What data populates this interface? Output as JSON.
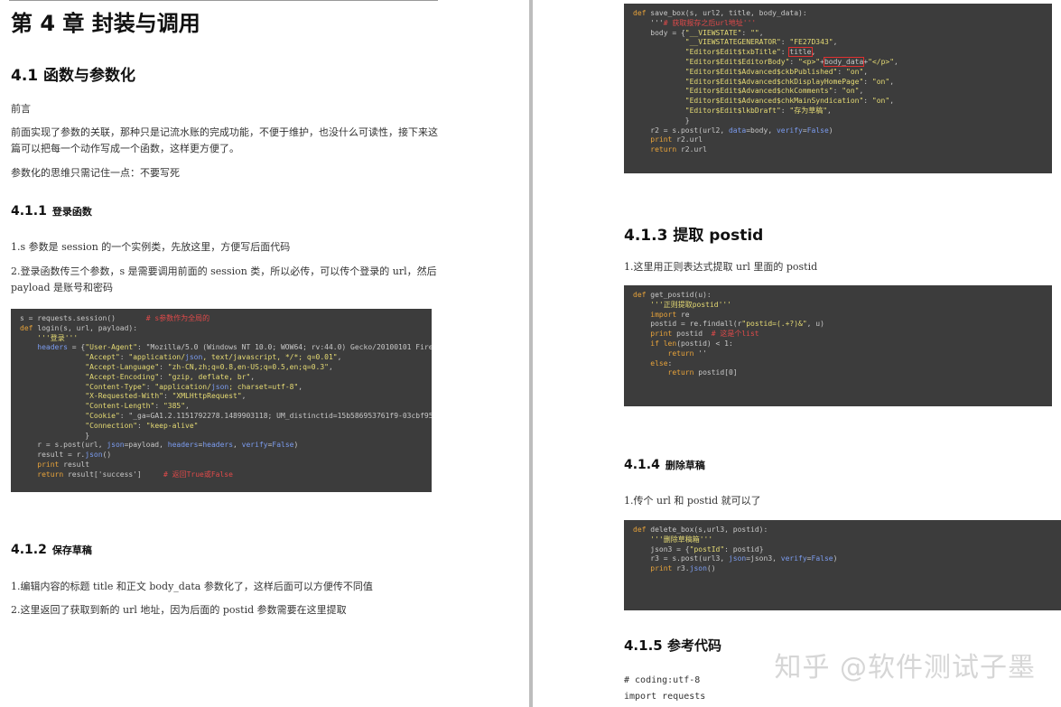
{
  "left": {
    "chapter_title": "第 4 章  封装与调用",
    "section_title": "4.1  函数与参数化",
    "preface_label": "前言",
    "preface_text": "前面实现了参数的关联，那种只是记流水账的完成功能，不便于维护，也没什么可读性，接下来这篇可以把每一个动作写成一个函数，这样更方便了。",
    "principle_text": "参数化的思维只需记住一点：不要写死",
    "s411": {
      "num": "4.1.1",
      "title": "登录函数"
    },
    "s411_p1": "1.s 参数是 session 的一个实例类，先放这里，方便写后面代码",
    "s411_p2": "2.登录函数传三个参数，s 是需要调用前面的 session 类，所以必传，可以传个登录的 url，然后 payload 是账号和密码",
    "login_code": [
      "s = requests.session()       # s参数作为全局的",
      "def login(s, url, payload):",
      "    '''登录'''",
      "    headers = {\"User-Agent\": \"Mozilla/5.0 (Windows NT 10.0; WOW64; rv:44.0) Gecko/20100101 Firef",
      "               \"Accept\": \"application/json, text/javascript, */*; q=0.01\",",
      "               \"Accept-Language\": \"zh-CN,zh;q=0.8,en-US;q=0.5,en;q=0.3\",",
      "               \"Accept-Encoding\": \"gzip, deflate, br\",",
      "               \"Content-Type\": \"application/json; charset=utf-8\",",
      "               \"X-Requested-With\": \"XMLHttpRequest\",",
      "               \"Content-Length\": \"385\",",
      "               \"Cookie\": \"_ga=GA1.2.1151792278.1489903118; UM_distinctid=15b586953761f9-03cbf959",
      "               \"Connection\": \"keep-alive\"",
      "               }",
      "    r = s.post(url, json=payload, headers=headers, verify=False)",
      "    result = r.json()",
      "    print result",
      "    return result['success']     # 返回True或False"
    ],
    "s412": {
      "num": "4.1.2",
      "title": "保存草稿"
    },
    "s412_p1": "1.编辑内容的标题 title 和正文 body_data 参数化了，这样后面可以方便传不同值",
    "s412_p2": "2.这里返回了获取到新的 url 地址，因为后面的 postid 参数需要在这里提取"
  },
  "right": {
    "save_code": [
      "def save_box(s, url2, title, body_data):",
      "    '''# 获取报存之后url地址'''",
      "    body = {\"__VIEWSTATE\": \"\",",
      "            \"__VIEWSTATEGENERATOR\": \"FE27D343\",",
      "            \"Editor$Edit$txbTitle\": title,",
      "            \"Editor$Edit$EditorBody\": \"<p>\"+body_data+\"</p>\",",
      "            \"Editor$Edit$Advanced$ckbPublished\": \"on\",",
      "            \"Editor$Edit$Advanced$chkDisplayHomePage\": \"on\",",
      "            \"Editor$Edit$Advanced$chkComments\": \"on\",",
      "            \"Editor$Edit$Advanced$chkMainSyndication\": \"on\",",
      "            \"Editor$Edit$lkbDraft\": \"存为草稿\",",
      "            }",
      "    r2 = s.post(url2, data=body, verify=False)",
      "    print r2.url",
      "    return r2.url"
    ],
    "s413": {
      "num": "4.1.3",
      "title": "提取 postid"
    },
    "s413_p1": "1.这里用正则表达式提取 url 里面的 postid",
    "postid_code": [
      "def get_postid(u):",
      "    '''正则提取postid'''",
      "    import re",
      "    postid = re.findall(r\"postid=(.+?)&\", u)",
      "    print postid  # 这是个list",
      "    if len(postid) < 1:",
      "        return ''",
      "    else:",
      "        return postid[0]"
    ],
    "s414": {
      "num": "4.1.4",
      "title": "删除草稿"
    },
    "s414_p1": "1.传个 url 和 postid 就可以了",
    "delete_code": [
      "def delete_box(s,url3, postid):",
      "    '''删除草稿箱'''",
      "    json3 = {\"postId\": postid}",
      "    r3 = s.post(url3, json=json3, verify=False)",
      "    print r3.json()"
    ],
    "s415": {
      "num": "4.1.5",
      "title": "参考代码"
    },
    "ref_line1": "# coding:utf-8",
    "ref_line2": "import requests",
    "watermark": "知乎 @软件测试子墨"
  }
}
